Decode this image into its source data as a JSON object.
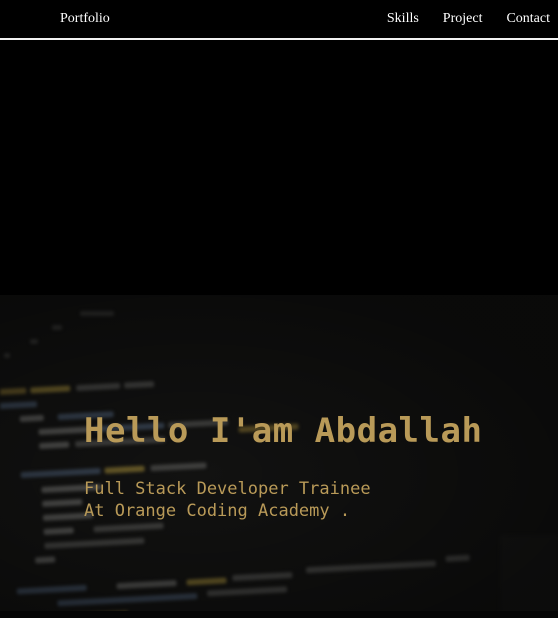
{
  "navbar": {
    "brand": "Portfolio",
    "links": [
      "Skills",
      "Project",
      "Contact"
    ]
  },
  "hero": {
    "title": "Hello I'am Abdallah",
    "subtitle_line1": "Full Stack Developer Trainee",
    "subtitle_line2": "At Orange Coding Academy ."
  },
  "colors": {
    "accent": "#b99a58",
    "background": "#000000",
    "nav_text": "#ffffff"
  }
}
